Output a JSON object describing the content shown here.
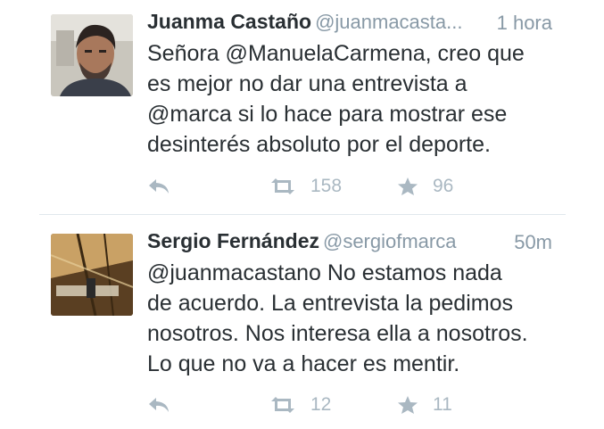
{
  "tweets": [
    {
      "name": "Juanma Castaño",
      "handle": "@juanmacasta...",
      "time": "1 hora",
      "text": "Señora @ManuelaCarmena, creo que\nes mejor no dar una entrevista a\n@marca si lo hace para mostrar ese\ndesinterés absoluto por el deporte.",
      "retweets": "158",
      "favorites": "96"
    },
    {
      "name": "Sergio Fernández",
      "handle": "@sergiofmarca",
      "time": "50m",
      "text": "@juanmacastano No estamos nada\nde acuerdo. La entrevista la pedimos\nnosotros. Nos interesa ella a nosotros.\nLo que no va a hacer es mentir.",
      "retweets": "12",
      "favorites": "11"
    }
  ],
  "icons": {
    "reply": "reply-icon",
    "retweet": "retweet-icon",
    "favorite": "star-icon"
  },
  "colors": {
    "name": "#292f33",
    "secondary": "#8899a6",
    "action": "#aab8c2",
    "divider": "#e1e8ed"
  }
}
